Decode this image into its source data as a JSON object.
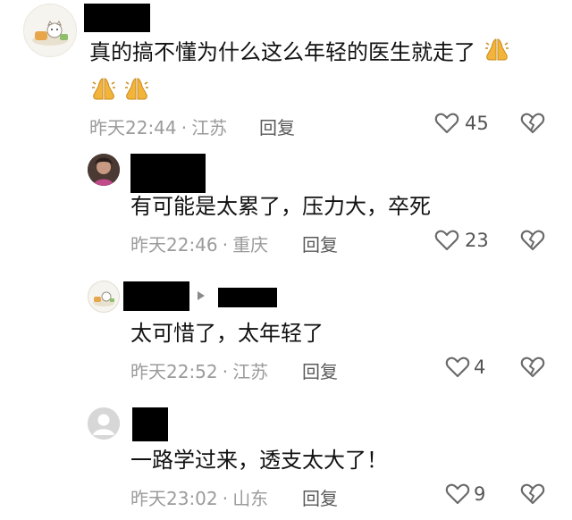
{
  "comments": [
    {
      "text": "真的搞不懂为什么这么年轻的医生就走了",
      "time": "昨天22:44",
      "location": "江苏",
      "reply_label": "回复",
      "likes": "45"
    },
    {
      "text": "有可能是太累了，压力大，卒死",
      "time": "昨天22:46",
      "location": "重庆",
      "reply_label": "回复",
      "likes": "23"
    },
    {
      "text": "太可惜了，太年轻了",
      "time": "昨天22:52",
      "location": "江苏",
      "reply_label": "回复",
      "likes": "4"
    },
    {
      "text": "一路学过来，透支太大了！",
      "time": "昨天23:02",
      "location": "山东",
      "reply_label": "回复",
      "likes": "9"
    }
  ],
  "separator": "·",
  "icons": {
    "like": "heart-outline-icon",
    "dislike": "broken-heart-icon",
    "pray": "folded-hands-emoji",
    "reply_arrow": "triangle-right-icon"
  },
  "colors": {
    "text": "#111111",
    "meta": "#9b9b9b",
    "icon": "#6a6a6a",
    "emoji": "#f2b43a"
  }
}
